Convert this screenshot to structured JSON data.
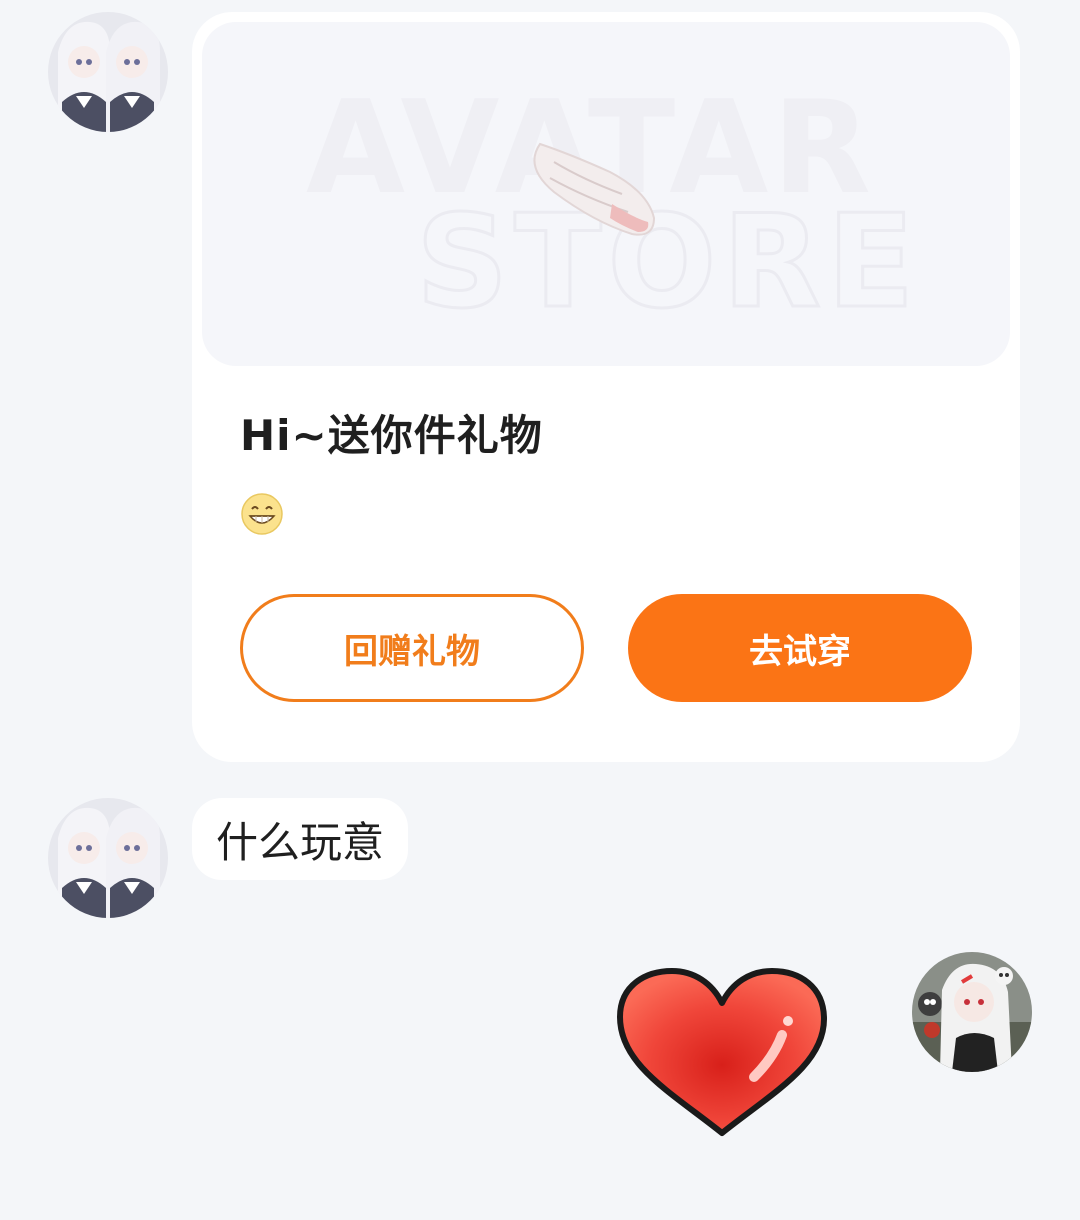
{
  "messages": {
    "gift_card": {
      "banner_title_line1": "AVATAR",
      "banner_title_line2": "STORE",
      "title": "Hi~送你件礼物",
      "emoji": "grinning-face-icon",
      "buttons": {
        "return_gift_label": "回赠礼物",
        "try_on_label": "去试穿"
      }
    },
    "text_message": {
      "text": "什么玩意"
    },
    "sticker": {
      "icon": "red-heart-sticker"
    }
  },
  "colors": {
    "accent": "#fb7415",
    "outline_button": "#f17d1b",
    "background": "#f4f6f9",
    "card": "#ffffff",
    "text": "#1f1f1f"
  }
}
